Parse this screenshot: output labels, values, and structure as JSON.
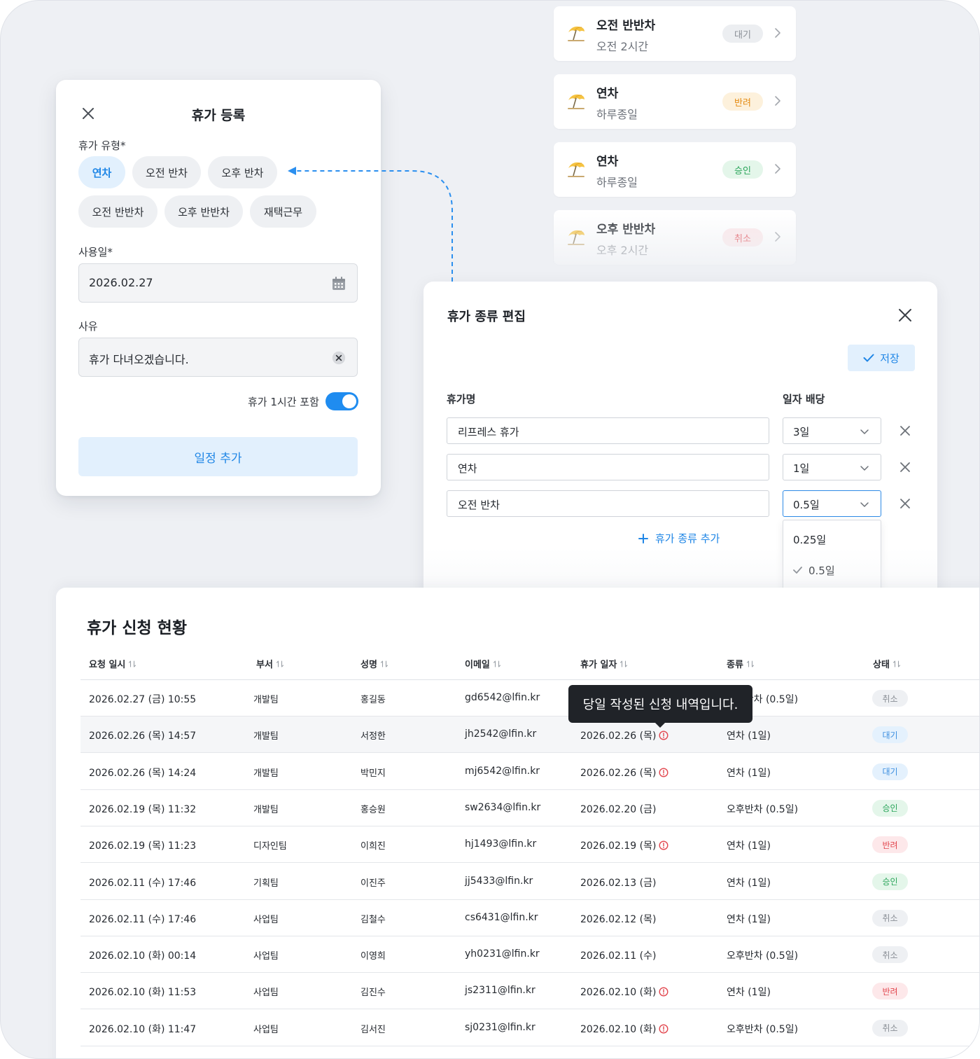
{
  "leave_list": [
    {
      "title": "오전 반반차",
      "sub": "오전 2시간",
      "badge": "대기",
      "badge_bg": "#eceef1",
      "badge_fg": "#8a8f96"
    },
    {
      "title": "연차",
      "sub": "하루종일",
      "badge": "반려",
      "badge_bg": "#fdf1dc",
      "badge_fg": "#e48a11"
    },
    {
      "title": "연차",
      "sub": "하루종일",
      "badge": "승인",
      "badge_bg": "#e4f6ea",
      "badge_fg": "#2aa55a"
    },
    {
      "title": "오후 반반차",
      "sub": "오후 2시간",
      "badge": "취소",
      "badge_bg": "#fde8ea",
      "badge_fg": "#e2474f"
    }
  ],
  "register_modal": {
    "title": "휴가 등록",
    "type_label": "휴가 유형*",
    "types": [
      "연차",
      "오전 반차",
      "오후 반차",
      "오전 반반차",
      "오후 반반차",
      "재택근무"
    ],
    "date_label": "사용일*",
    "date_value": "2026.02.27",
    "reason_label": "사유",
    "reason_value": "휴가 다녀오겠습니다.",
    "toggle_label": "휴가 1시간 포함",
    "toggle_on": true,
    "submit_label": "일정 추가"
  },
  "type_edit": {
    "title": "휴가 종류 편집",
    "save_label": "저장",
    "col_name": "휴가명",
    "col_days": "일자 배당",
    "rows": [
      {
        "name": "리프레스 휴가",
        "days": "3일"
      },
      {
        "name": "연차",
        "days": "1일"
      },
      {
        "name": "오전 반차",
        "days": "0.5일"
      }
    ],
    "add_label": "휴가 종류 추가",
    "dropdown_options": [
      "0.25일",
      "0.5일"
    ],
    "dropdown_selected": "0.5일"
  },
  "table": {
    "title": "휴가 신청 현황",
    "headers": [
      "요청 일시",
      "부서",
      "성명",
      "이메일",
      "휴가 일자",
      "종류",
      "상태"
    ],
    "tooltip": "당일 작성된 신청 내역입니다.",
    "rows": [
      {
        "req": "2026.02.27 (금) 10:55",
        "dept": "개발팀",
        "name": "홍길동",
        "email": "gd6542@lfin.kr",
        "date": "",
        "warn": false,
        "kind": "오전반차 (0.5일)",
        "status": "취소"
      },
      {
        "req": "2026.02.26 (목) 14:57",
        "dept": "개발팀",
        "name": "서정한",
        "email": "jh2542@lfin.kr",
        "date": "2026.02.26 (목)",
        "warn": true,
        "kind": "연차 (1일)",
        "status": "대기"
      },
      {
        "req": "2026.02.26 (목) 14:24",
        "dept": "개발팀",
        "name": "박민지",
        "email": "mj6542@lfin.kr",
        "date": "2026.02.26 (목)",
        "warn": true,
        "kind": "연차 (1일)",
        "status": "대기"
      },
      {
        "req": "2026.02.19 (목) 11:32",
        "dept": "개발팀",
        "name": "홍승원",
        "email": "sw2634@lfin.kr",
        "date": "2026.02.20 (금)",
        "warn": false,
        "kind": "오후반차 (0.5일)",
        "status": "승인"
      },
      {
        "req": "2026.02.19 (목) 11:23",
        "dept": "디자인팀",
        "name": "이희진",
        "email": "hj1493@lfin.kr",
        "date": "2026.02.19 (목)",
        "warn": true,
        "kind": "연차 (1일)",
        "status": "반려"
      },
      {
        "req": "2026.02.11 (수) 17:46",
        "dept": "기획팀",
        "name": "이진주",
        "email": "jj5433@lfin.kr",
        "date": "2026.02.13 (금)",
        "warn": false,
        "kind": "연차 (1일)",
        "status": "승인"
      },
      {
        "req": "2026.02.11 (수) 17:46",
        "dept": "사업팀",
        "name": "김철수",
        "email": "cs6431@lfin.kr",
        "date": "2026.02.12 (목)",
        "warn": false,
        "kind": "연차 (1일)",
        "status": "취소"
      },
      {
        "req": "2026.02.10 (화) 00:14",
        "dept": "사업팀",
        "name": "이영희",
        "email": "yh0231@lfin.kr",
        "date": "2026.02.11 (수)",
        "warn": false,
        "kind": "오후반차 (0.5일)",
        "status": "취소"
      },
      {
        "req": "2026.02.10 (화) 11:53",
        "dept": "사업팀",
        "name": "김진수",
        "email": "js2311@lfin.kr",
        "date": "2026.02.10 (화)",
        "warn": true,
        "kind": "연차 (1일)",
        "status": "반려"
      },
      {
        "req": "2026.02.10 (화) 11:47",
        "dept": "사업팀",
        "name": "김서진",
        "email": "sj0231@lfin.kr",
        "date": "2026.02.10 (화)",
        "warn": true,
        "kind": "오후반차 (0.5일)",
        "status": "취소"
      }
    ]
  },
  "colors": {
    "accent": "#1f86e6",
    "accent_light": "#e2f0fd",
    "status_cancel": "#8a8f96",
    "status_wait": "#3d8fe0",
    "status_approve": "#2aa55a",
    "status_reject": "#e2474f"
  }
}
